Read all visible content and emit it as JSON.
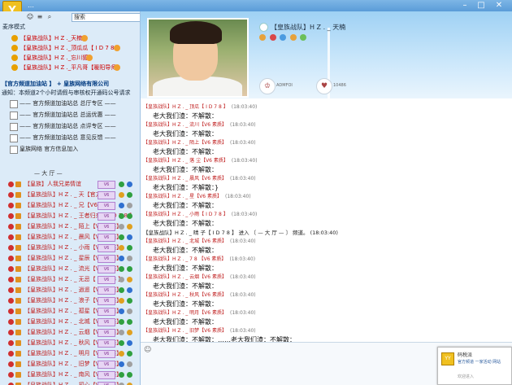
{
  "window": {
    "title": "…",
    "controls": [
      "–",
      "□",
      "✕"
    ]
  },
  "toolbar": {
    "search_value": "搜索"
  },
  "left": {
    "mode_label": "麦序模式",
    "mode_right": "排麦",
    "stage": [
      "【皇族战队】H Z ._天楠",
      "【皇族战队】H Z ._顶瓜瓜【 I D 7 8 】",
      "【皇族战队】H Z ._忘川狐",
      "【皇族战队】H Z ._平凡哥【暖阳导师】"
    ],
    "notice_title": "【官方频道加油站 】 + 皇族网络有限公司",
    "notice_sub": "通知：本频道2个小时请假与审核权开通码公号请求",
    "channels": [
      "—— 官方频道加油站总 总厅专区 ——",
      "—— 官方频道加油站总 总运优惠 ——",
      "—— 官方频道加油站总 点评专区 ——",
      "—— 官方频道加油站总 意见反馈 ——",
      "皇族网络 官方信息加入"
    ],
    "hall_label": "— 大 厅 —",
    "users": [
      "【皇族】人我兄弟情谊",
      "【皇族战队】H Z . _ 天【官方导师】",
      "【皇族战队】H Z . _ 兄【V6 素质】",
      "【皇族战队】H Z . _ 王者归来【 I D 7 8 】",
      "【皇族战队】H Z . _ 陌上【V6 素质】",
      "【皇族战队】H Z . _ 晨风【V6 素质】",
      "【皇族战队】H Z . _ 小雨【V6 素质】",
      "【皇族战队】H Z . _ 星辰【V6 素质】",
      "【皇族战队】H Z . _ 流光【V6 素质】",
      "【皇族战队】H Z . _ 无忌【 I D 7 8 】",
      "【皇族战队】H Z . _ 逍遥【V6 素质】",
      "【皇族战队】H Z . _ 浪子【V6 素质】",
      "【皇族战队】H Z . _ 孤星【V6 素质】",
      "【皇族战队】H Z . _ 北城【V6 素质】",
      "【皇族战队】H Z . _ 云烟【V6 素质】",
      "【皇族战队】H Z . _ 秋风【V6 素质】",
      "【皇族战队】H Z . _ 明月【V6 素质】",
      "【皇族战队】H Z . _ 旧梦【V6 素质】",
      "【皇族战队】H Z . _ 南风【V6 素质】",
      "【皇族战队】H Z . _ 初心【V6 素质】"
    ],
    "badge_text": "V6"
  },
  "host": {
    "name": "【皇族战队】H Z . _ 天楠",
    "btn1": "ADMFOI",
    "btn2": "10486"
  },
  "chat": {
    "messages": [
      {
        "head": "【皇族战队】H Z . _ 顶瓜【 I D 7 8 】",
        "time": "(18:03:40)",
        "body": "老大我们渣：不解散："
      },
      {
        "head": "【皇族战队】H Z . _ 流川【V6 素质】",
        "time": "(18:03:40)",
        "body": "老大我们渣：不解散："
      },
      {
        "head": "【皇族战队】H Z . _ 陌上【V6 素质】",
        "time": "(18:03:40)",
        "body": "老大我们渣：不解散："
      },
      {
        "head": "【皇族战队】H Z . _ 落 尘【V6 素质】",
        "time": "(18:03:40)",
        "body": "老大我们渣：不解散："
      },
      {
        "head": "【皇族战队】H Z . _ 晨风【V6 素质】",
        "time": "(18:03:40)",
        "body": "老大我们渣：不解散：}"
      },
      {
        "head": "【皇族战队】H Z . _ 星【V6 素质】",
        "time": "(18:03:40)",
        "body": "老大我们渣：不解散："
      },
      {
        "head": "【皇族战队】H Z . _ 小雨【 I D 7 8 】",
        "time": "(18:03:40)",
        "body": "老大我们渣：不解散："
      }
    ],
    "system": "【皇族战队】H Z . _ 晴 子【 I D 7 8 】 进入 〔 — 大 厅 — 〕 频道。 (18:03:40)",
    "messages2": [
      {
        "head": "【皇族战队】H Z . _ 北城【V6 素质】",
        "time": "(18:03:40)",
        "body": "老大我们渣：不解散："
      },
      {
        "head": "【皇族战队】H Z . _ 7 8 【V6 素质】",
        "time": "(18:03:40)",
        "body": "老大我们渣：不解散："
      },
      {
        "head": "【皇族战队】H Z . _ 云烟【V6 素质】",
        "time": "(18:03:40)",
        "body": "老大我们渣：不解散："
      },
      {
        "head": "【皇族战队】H Z . _ 秋风【V6 素质】",
        "time": "(18:03:40)",
        "body": "老大我们渣：不解散："
      },
      {
        "head": "【皇族战队】H Z . _ 明月【V6 素质】",
        "time": "(18:03:40)",
        "body": "老大我们渣：不解散："
      },
      {
        "head": "【皇族战队】H Z . _ 旧梦【V6 素质】",
        "time": "(18:03:40)",
        "body": "老大我们渣：不解散：……老大我们渣：不解散："
      }
    ]
  },
  "toast": {
    "title": "码税派",
    "text": "官方频道 一家活动 网站",
    "sub": "欢迎进入"
  }
}
